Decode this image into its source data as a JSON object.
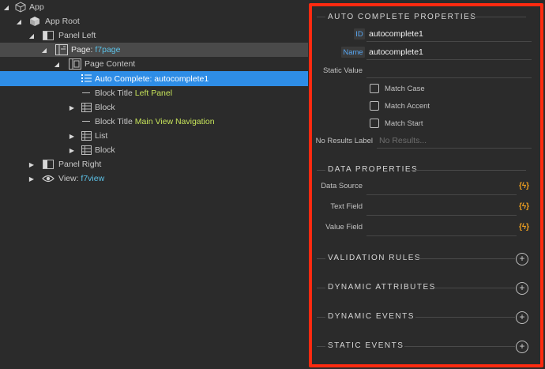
{
  "tree": {
    "app": "App",
    "app_root": "App Root",
    "panel_left": "Panel Left",
    "page_prefix": "Page: ",
    "page_name": "f7page",
    "page_content": "Page Content",
    "autocomplete_prefix": "Auto Complete: ",
    "autocomplete_name": "autocomplete1",
    "block_title_1_prefix": "Block Title ",
    "block_title_1_text": "Left Panel",
    "block_1": "Block",
    "block_title_2_prefix": "Block Title ",
    "block_title_2_text": "Main View Navigation",
    "list": "List",
    "block_2": "Block",
    "panel_right": "Panel Right",
    "view_prefix": "View: ",
    "view_name": "f7view"
  },
  "props": {
    "section_title": "AUTO COMPLETE PROPERTIES",
    "id_label": "ID",
    "id_value": "autocomplete1",
    "name_label": "Name",
    "name_value": "autocomplete1",
    "static_value_label": "Static Value",
    "static_value": "",
    "match_case": "Match Case",
    "match_accent": "Match Accent",
    "match_start": "Match Start",
    "no_results_label": "No Results Label",
    "no_results_placeholder": "No Results..."
  },
  "data_props": {
    "section_title": "DATA PROPERTIES",
    "data_source": "Data Source",
    "text_field": "Text Field",
    "value_field": "Value Field",
    "bind_glyph": "{ϟ}"
  },
  "collapsed": {
    "validation_rules": "VALIDATION RULES",
    "dynamic_attributes": "DYNAMIC ATTRIBUTES",
    "dynamic_events": "DYNAMIC EVENTS",
    "static_events": "STATIC EVENTS",
    "plus_glyph": "+"
  }
}
